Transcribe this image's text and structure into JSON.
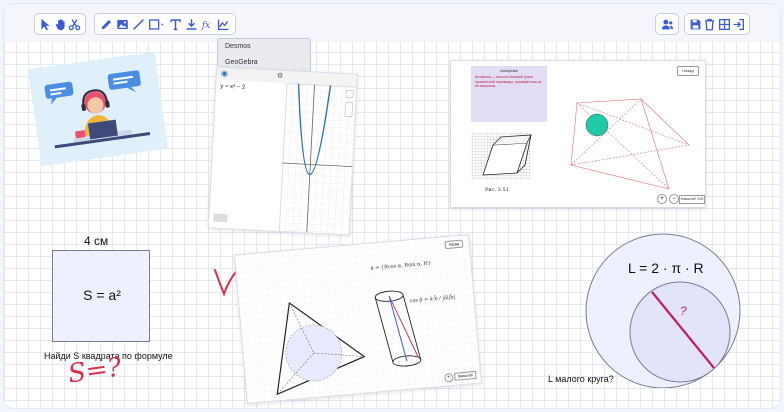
{
  "toolbar": {
    "left_groups": [
      [
        "cursor-icon",
        "hand-icon",
        "scissors-icon"
      ],
      [
        "pencil-icon",
        "image-icon",
        "line-icon",
        "square-icon",
        "text-icon",
        "download-icon",
        "formula-icon",
        "chart-icon"
      ]
    ],
    "right_groups": [
      [
        "users-icon"
      ],
      [
        "save-icon",
        "trash-icon",
        "grid-icon",
        "exit-icon"
      ]
    ]
  },
  "menu": {
    "items": [
      "Desmos",
      "GeoGebra"
    ]
  },
  "desmos": {
    "expr": "y = x² − 2"
  },
  "textbook": {
    "top_button": "Назад",
    "heading": "Апофема",
    "definition": "Апофема — высота боковой грани правильной пирамиды, проведённая из её вершины.",
    "caption": "Рис. 3.51",
    "bottom_label": "Масштаб: 100"
  },
  "cylinder": {
    "formula1": "ā = {Rcos α, Rsin α, H}",
    "formula2": "cos β = ā·b̄ / |ā||b̄|",
    "top_button": "Назад",
    "bottom_label": "Масштаб"
  },
  "square": {
    "side_label": "4 см",
    "area_formula": "S = a²",
    "task": "Найди S квадрата по формуле",
    "handwriting": "S=?"
  },
  "circle": {
    "formula": "L = 2 · π · R",
    "question_mark": "?",
    "task": "L малого круга?"
  },
  "colors": {
    "accent": "#3b5bd6",
    "handwriting": "#d9304b",
    "teal": "#20c9a8"
  }
}
